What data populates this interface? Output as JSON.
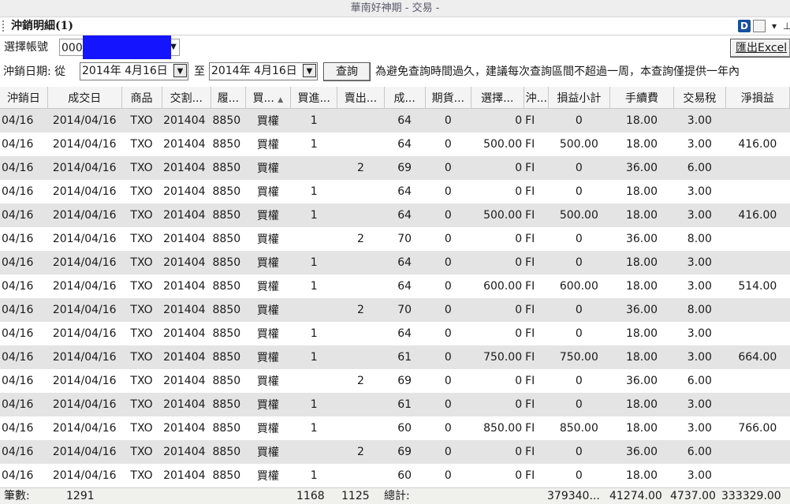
{
  "window": {
    "title": "華南好神期 - 交易 -"
  },
  "panel": {
    "title": "沖銷明細(1)",
    "icon_d": "D"
  },
  "account": {
    "label": "選擇帳號",
    "value": "000",
    "export_label": "匯出Excel"
  },
  "date_filter": {
    "label": "沖銷日期: 從",
    "from": "2014年 4月16日",
    "to_label": "至",
    "to": "2014年 4月16日",
    "query_label": "查詢",
    "notice": "為避免查詢時間過久，建議每次查詢區間不超過一周，本查詢僅提供一年內"
  },
  "table": {
    "columns": [
      "沖銷日",
      "成交日",
      "商品",
      "交割...",
      "履...",
      "買...",
      "買進...",
      "賣出...",
      "成...",
      "期貨...",
      "選擇...",
      "沖...",
      "損益小計",
      "手續費",
      "交易稅",
      "淨損益"
    ],
    "rows": [
      [
        "04/16",
        "2014/04/16",
        "TXO",
        "201404",
        "8850",
        "買權",
        "1",
        "",
        "64",
        "0",
        "0",
        "FI",
        "0",
        "18.00",
        "3.00",
        ""
      ],
      [
        "04/16",
        "2014/04/16",
        "TXO",
        "201404",
        "8850",
        "買權",
        "1",
        "",
        "64",
        "0",
        "500.00",
        "FI",
        "500.00",
        "18.00",
        "3.00",
        "416.00"
      ],
      [
        "04/16",
        "2014/04/16",
        "TXO",
        "201404",
        "8850",
        "買權",
        "",
        "2",
        "69",
        "0",
        "0",
        "FI",
        "0",
        "36.00",
        "6.00",
        ""
      ],
      [
        "04/16",
        "2014/04/16",
        "TXO",
        "201404",
        "8850",
        "買權",
        "1",
        "",
        "64",
        "0",
        "0",
        "FI",
        "0",
        "18.00",
        "3.00",
        ""
      ],
      [
        "04/16",
        "2014/04/16",
        "TXO",
        "201404",
        "8850",
        "買權",
        "1",
        "",
        "64",
        "0",
        "500.00",
        "FI",
        "500.00",
        "18.00",
        "3.00",
        "416.00"
      ],
      [
        "04/16",
        "2014/04/16",
        "TXO",
        "201404",
        "8850",
        "買權",
        "",
        "2",
        "70",
        "0",
        "0",
        "FI",
        "0",
        "36.00",
        "8.00",
        ""
      ],
      [
        "04/16",
        "2014/04/16",
        "TXO",
        "201404",
        "8850",
        "買權",
        "1",
        "",
        "64",
        "0",
        "0",
        "FI",
        "0",
        "18.00",
        "3.00",
        ""
      ],
      [
        "04/16",
        "2014/04/16",
        "TXO",
        "201404",
        "8850",
        "買權",
        "1",
        "",
        "64",
        "0",
        "600.00",
        "FI",
        "600.00",
        "18.00",
        "3.00",
        "514.00"
      ],
      [
        "04/16",
        "2014/04/16",
        "TXO",
        "201404",
        "8850",
        "買權",
        "",
        "2",
        "70",
        "0",
        "0",
        "FI",
        "0",
        "36.00",
        "8.00",
        ""
      ],
      [
        "04/16",
        "2014/04/16",
        "TXO",
        "201404",
        "8850",
        "買權",
        "1",
        "",
        "64",
        "0",
        "0",
        "FI",
        "0",
        "18.00",
        "3.00",
        ""
      ],
      [
        "04/16",
        "2014/04/16",
        "TXO",
        "201404",
        "8850",
        "買權",
        "1",
        "",
        "61",
        "0",
        "750.00",
        "FI",
        "750.00",
        "18.00",
        "3.00",
        "664.00"
      ],
      [
        "04/16",
        "2014/04/16",
        "TXO",
        "201404",
        "8850",
        "買權",
        "",
        "2",
        "69",
        "0",
        "0",
        "FI",
        "0",
        "36.00",
        "6.00",
        ""
      ],
      [
        "04/16",
        "2014/04/16",
        "TXO",
        "201404",
        "8850",
        "買權",
        "1",
        "",
        "61",
        "0",
        "0",
        "FI",
        "0",
        "18.00",
        "3.00",
        ""
      ],
      [
        "04/16",
        "2014/04/16",
        "TXO",
        "201404",
        "8850",
        "買權",
        "1",
        "",
        "60",
        "0",
        "850.00",
        "FI",
        "850.00",
        "18.00",
        "3.00",
        "766.00"
      ],
      [
        "04/16",
        "2014/04/16",
        "TXO",
        "201404",
        "8850",
        "買權",
        "",
        "2",
        "69",
        "0",
        "0",
        "FI",
        "0",
        "36.00",
        "6.00",
        ""
      ],
      [
        "04/16",
        "2014/04/16",
        "TXO",
        "201404",
        "8850",
        "買權",
        "1",
        "",
        "60",
        "0",
        "0",
        "FI",
        "0",
        "18.00",
        "3.00",
        ""
      ]
    ]
  },
  "footer": {
    "count_label": "筆數:",
    "count": "1291",
    "buy_total": "1168",
    "sell_total": "1125",
    "total_label": "總計:",
    "pl_total": "379340...",
    "fee_total": "41274.00",
    "tax_total": "4737.00",
    "net_total": "333329.00"
  },
  "colors": {
    "row_alt": "#e4e4e4",
    "mask": "#1414ff",
    "icon_d": "#1a4f9c"
  },
  "icons": [
    "d-icon",
    "document-icon",
    "dropdown-arrow-icon",
    "pin-icon",
    "sort-ascending-icon",
    "calendar-dropdown-icon"
  ]
}
